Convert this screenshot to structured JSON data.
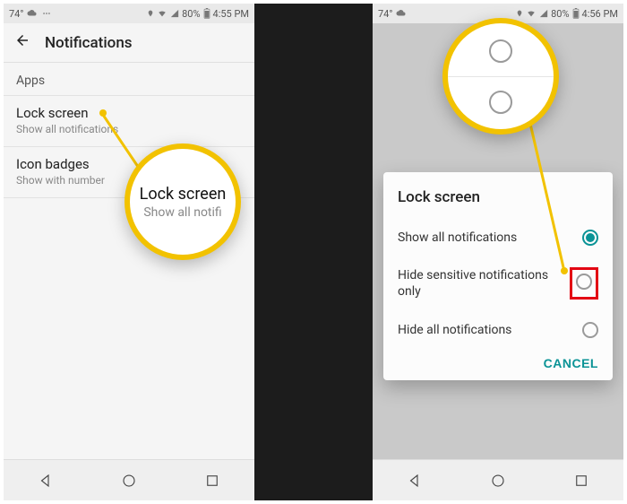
{
  "left": {
    "status": {
      "temp": "74°",
      "signal": "80%",
      "time": "4:55 PM"
    },
    "header_title": "Notifications",
    "section_apps": "Apps",
    "lock": {
      "title": "Lock screen",
      "sub": "Show all notifications"
    },
    "badges": {
      "title": "Icon badges",
      "sub": "Show with number"
    }
  },
  "right": {
    "status": {
      "temp": "74°",
      "signal": "80%",
      "time": "4:56 PM"
    },
    "dialog": {
      "title": "Lock screen",
      "opt1": "Show all notifications",
      "opt2": "Hide sensitive notifications only",
      "opt3": "Hide all notifications",
      "cancel": "CANCEL"
    }
  },
  "mag1": {
    "title": "Lock screen",
    "sub": "Show all notifi"
  }
}
